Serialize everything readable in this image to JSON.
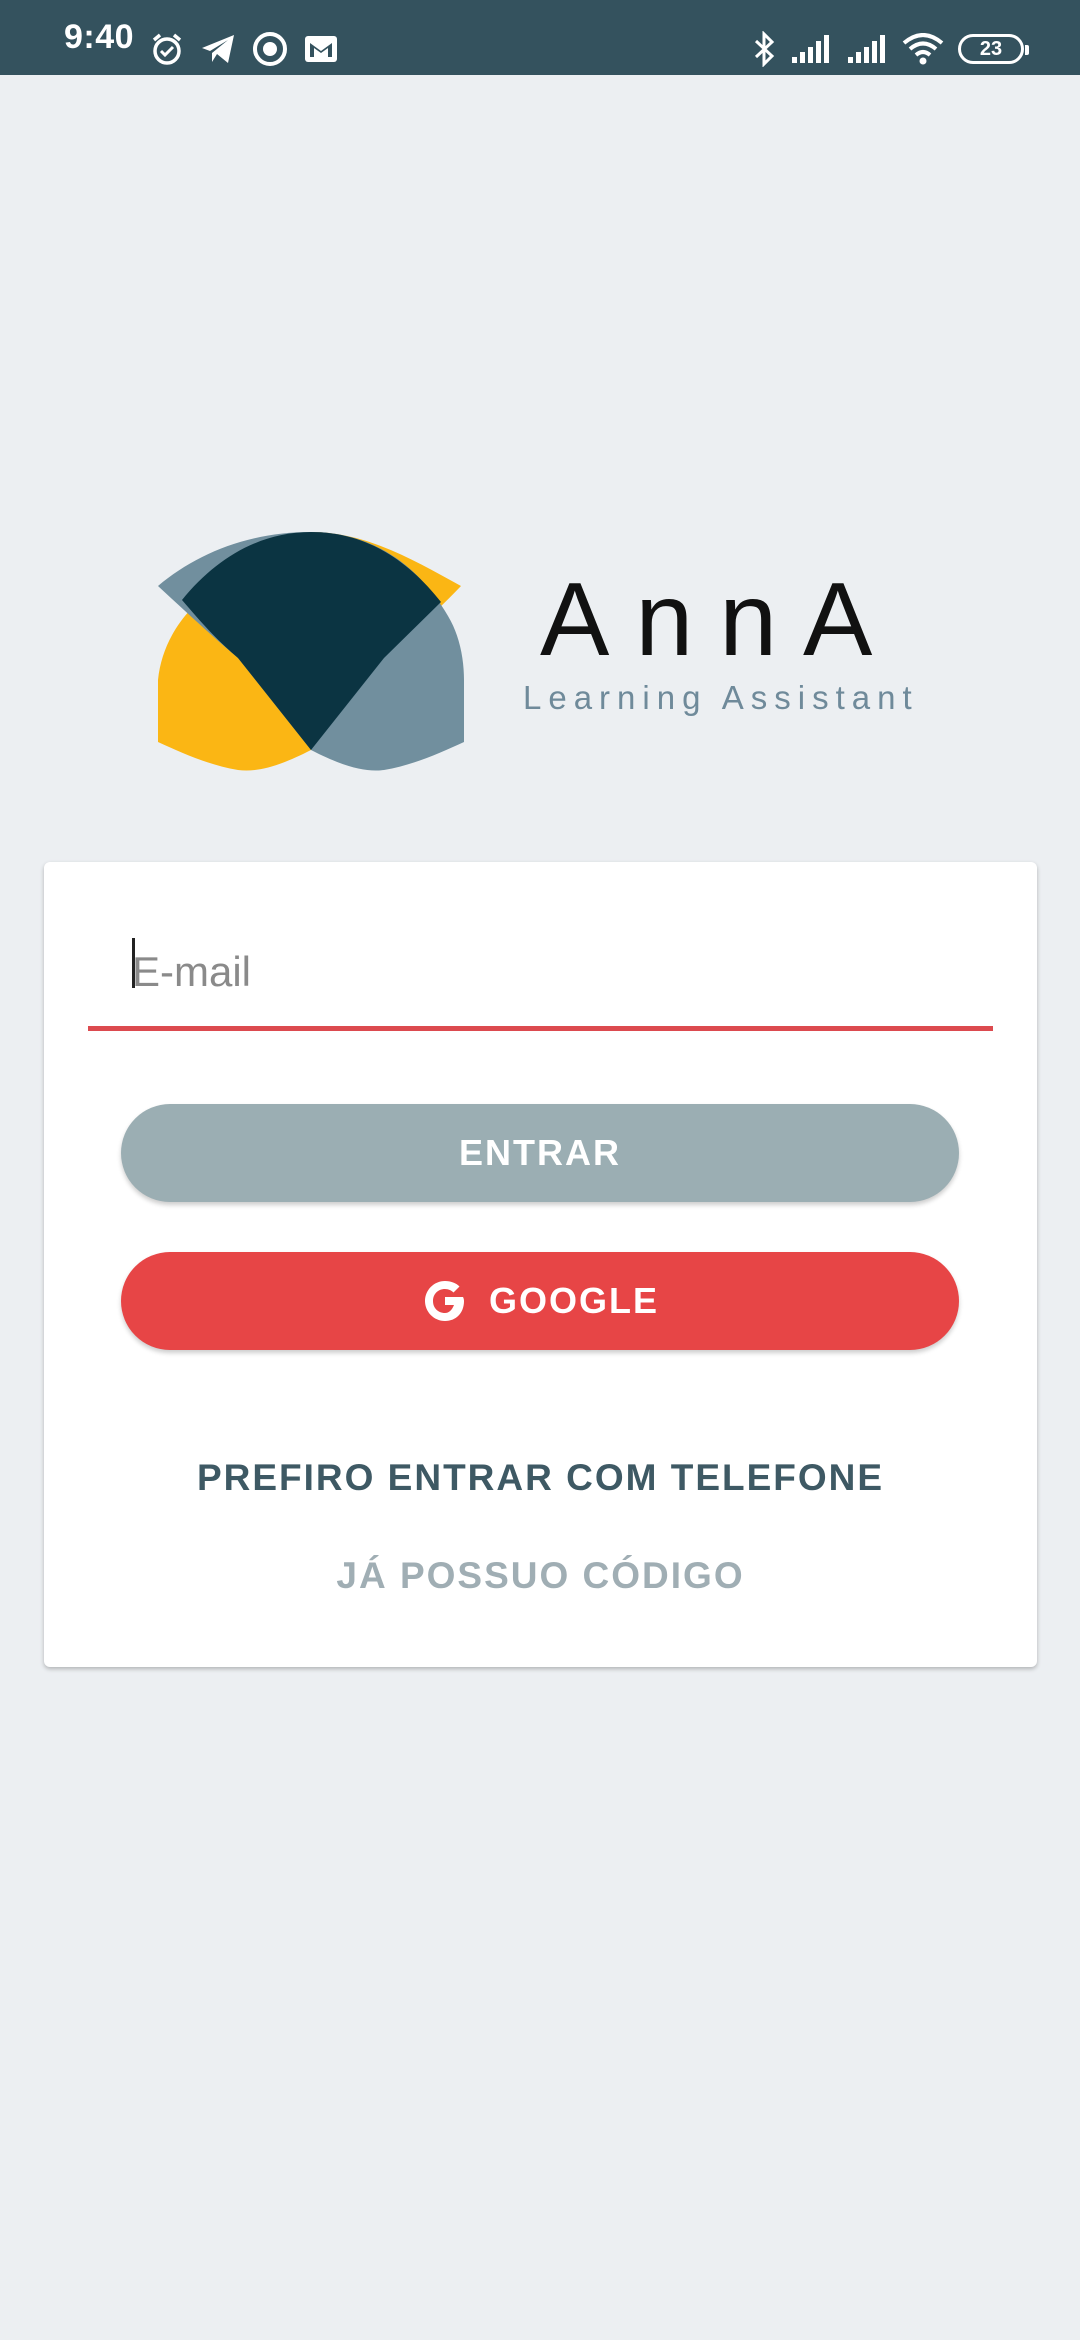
{
  "status_bar": {
    "time": "9:40",
    "battery": "23",
    "left_icons": [
      "alarm-icon",
      "telegram-icon",
      "circle-app-icon",
      "gmail-icon"
    ],
    "right_icons": [
      "bluetooth-icon",
      "signal-icon",
      "signal-icon",
      "wifi-icon",
      "battery-icon"
    ]
  },
  "brand": {
    "name": "AnnA",
    "tagline": "Learning Assistant",
    "logo_colors": {
      "yellow": "#fbb614",
      "navy": "#0b3442",
      "slate": "#718f9e"
    }
  },
  "login": {
    "email_placeholder": "E-mail",
    "email_value": "",
    "email_underline_color": "#dc4a4f",
    "entrar_label": "ENTRAR",
    "entrar_color": "#9baeb3",
    "google_label": "GOOGLE",
    "google_color": "#e74546",
    "phone_link": "PREFIRO ENTRAR COM TELEFONE",
    "code_link": "JÁ POSSUO CÓDIGO"
  }
}
